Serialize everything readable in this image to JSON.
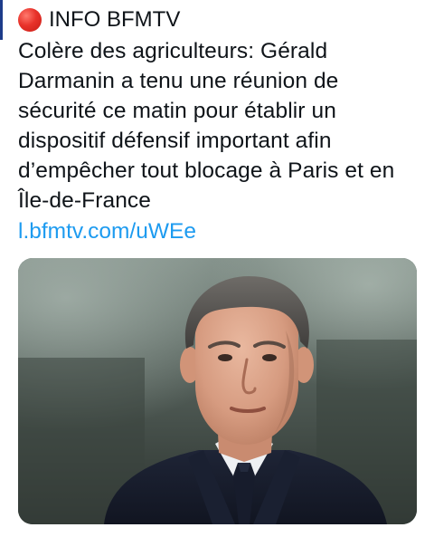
{
  "post": {
    "status_icon": "red-circle-icon",
    "source": "INFO BFMTV",
    "text": "Colère des agriculteurs: Gérald Darmanin a tenu une réunion de sécurité ce matin pour établir un dispositif défensif important afin d’empêcher tout blocage à Paris et en Île-de-France",
    "link": "l.bfmtv.com/uWEe",
    "image_subject": "man-portrait-photo"
  },
  "colors": {
    "link": "#1d9bf0",
    "text": "#0f1419",
    "dot": "#e8322a"
  }
}
